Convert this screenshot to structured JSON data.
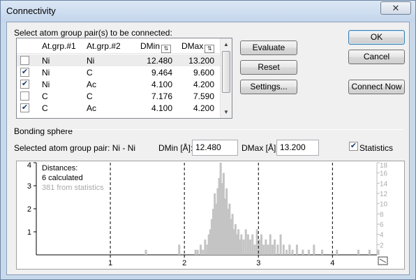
{
  "window": {
    "title": "Connectivity",
    "close_glyph": "✕"
  },
  "selection": {
    "label": "Select atom group pair(s) to be connected:",
    "columns": [
      "At.grp.#1",
      "At.grp.#2",
      "DMin",
      "DMax"
    ],
    "sort_icon": "sort-icon",
    "rows": [
      {
        "checked": false,
        "g1": "Ni",
        "g2": "Ni",
        "dmin": "12.480",
        "dmax": "13.200",
        "selected": true
      },
      {
        "checked": true,
        "g1": "Ni",
        "g2": "C",
        "dmin": "9.464",
        "dmax": "9.600",
        "selected": false
      },
      {
        "checked": true,
        "g1": "Ni",
        "g2": "Ac",
        "dmin": "4.100",
        "dmax": "4.200",
        "selected": false
      },
      {
        "checked": false,
        "g1": "C",
        "g2": "C",
        "dmin": "7.176",
        "dmax": "7.590",
        "selected": false
      },
      {
        "checked": true,
        "g1": "C",
        "g2": "Ac",
        "dmin": "4.100",
        "dmax": "4.200",
        "selected": false
      }
    ]
  },
  "buttons": {
    "evaluate": "Evaluate",
    "reset": "Reset",
    "settings": "Settings...",
    "ok": "OK",
    "cancel": "Cancel",
    "connect_now": "Connect Now"
  },
  "bonding": {
    "section_label": "Bonding sphere",
    "pair_label": "Selected atom group pair: Ni - Ni",
    "dmin_label": "DMin [Å]:",
    "dmin_value": "12.480",
    "dmax_label": "DMax [Å]:",
    "dmax_value": "13.200",
    "statistics_label": "Statistics",
    "statistics_checked": true
  },
  "chart_data": {
    "type": "bar",
    "legend": [
      "Distances:",
      "6 calculated",
      "381 from statistics"
    ],
    "x_ticks": [
      "1",
      "2",
      "3",
      "4"
    ],
    "x_range": [
      0,
      4.0
    ],
    "dashed_x": [
      1,
      2,
      3,
      4
    ],
    "y_left_ticks": [
      "1",
      "2",
      "3",
      "4"
    ],
    "y_left_range": [
      0,
      4
    ],
    "y_right_ticks": [
      "2",
      "4",
      "6",
      "8",
      "10",
      "12",
      "14",
      "16",
      "18"
    ],
    "y_right_range": [
      0,
      18
    ],
    "end_icon": "axis-scale-icon",
    "colors": {
      "statistics": "#c4c4c4",
      "calculated": "#000000"
    },
    "calculated_bins": [],
    "statistics_bins": [
      {
        "x": 1.48,
        "v": 1
      },
      {
        "x": 1.93,
        "v": 2
      },
      {
        "x": 2.15,
        "v": 1
      },
      {
        "x": 2.18,
        "v": 1
      },
      {
        "x": 2.22,
        "v": 2
      },
      {
        "x": 2.25,
        "v": 1
      },
      {
        "x": 2.28,
        "v": 3
      },
      {
        "x": 2.31,
        "v": 2
      },
      {
        "x": 2.33,
        "v": 4
      },
      {
        "x": 2.35,
        "v": 5
      },
      {
        "x": 2.37,
        "v": 7
      },
      {
        "x": 2.39,
        "v": 9
      },
      {
        "x": 2.41,
        "v": 12
      },
      {
        "x": 2.43,
        "v": 10
      },
      {
        "x": 2.45,
        "v": 13
      },
      {
        "x": 2.47,
        "v": 15
      },
      {
        "x": 2.49,
        "v": 18
      },
      {
        "x": 2.51,
        "v": 14
      },
      {
        "x": 2.53,
        "v": 16
      },
      {
        "x": 2.55,
        "v": 11
      },
      {
        "x": 2.57,
        "v": 13
      },
      {
        "x": 2.59,
        "v": 9
      },
      {
        "x": 2.61,
        "v": 10
      },
      {
        "x": 2.63,
        "v": 7
      },
      {
        "x": 2.65,
        "v": 8
      },
      {
        "x": 2.67,
        "v": 5
      },
      {
        "x": 2.69,
        "v": 6
      },
      {
        "x": 2.71,
        "v": 4
      },
      {
        "x": 2.73,
        "v": 5
      },
      {
        "x": 2.75,
        "v": 3
      },
      {
        "x": 2.77,
        "v": 4
      },
      {
        "x": 2.8,
        "v": 3
      },
      {
        "x": 2.83,
        "v": 5
      },
      {
        "x": 2.86,
        "v": 4
      },
      {
        "x": 2.89,
        "v": 3
      },
      {
        "x": 2.92,
        "v": 4
      },
      {
        "x": 2.95,
        "v": 2
      },
      {
        "x": 2.98,
        "v": 5
      },
      {
        "x": 3.01,
        "v": 3
      },
      {
        "x": 3.04,
        "v": 4
      },
      {
        "x": 3.07,
        "v": 2
      },
      {
        "x": 3.1,
        "v": 3
      },
      {
        "x": 3.13,
        "v": 2
      },
      {
        "x": 3.16,
        "v": 4
      },
      {
        "x": 3.19,
        "v": 2
      },
      {
        "x": 3.22,
        "v": 3
      },
      {
        "x": 3.26,
        "v": 2
      },
      {
        "x": 3.3,
        "v": 4
      },
      {
        "x": 3.34,
        "v": 2
      },
      {
        "x": 3.38,
        "v": 1
      },
      {
        "x": 3.42,
        "v": 2
      },
      {
        "x": 3.46,
        "v": 1
      },
      {
        "x": 3.52,
        "v": 2
      },
      {
        "x": 3.6,
        "v": 1
      },
      {
        "x": 3.68,
        "v": 1
      },
      {
        "x": 3.75,
        "v": 2
      },
      {
        "x": 3.86,
        "v": 1
      },
      {
        "x": 4.06,
        "v": 1
      },
      {
        "x": 4.35,
        "v": 1
      },
      {
        "x": 4.5,
        "v": 1
      },
      {
        "x": 4.62,
        "v": 1
      }
    ]
  }
}
